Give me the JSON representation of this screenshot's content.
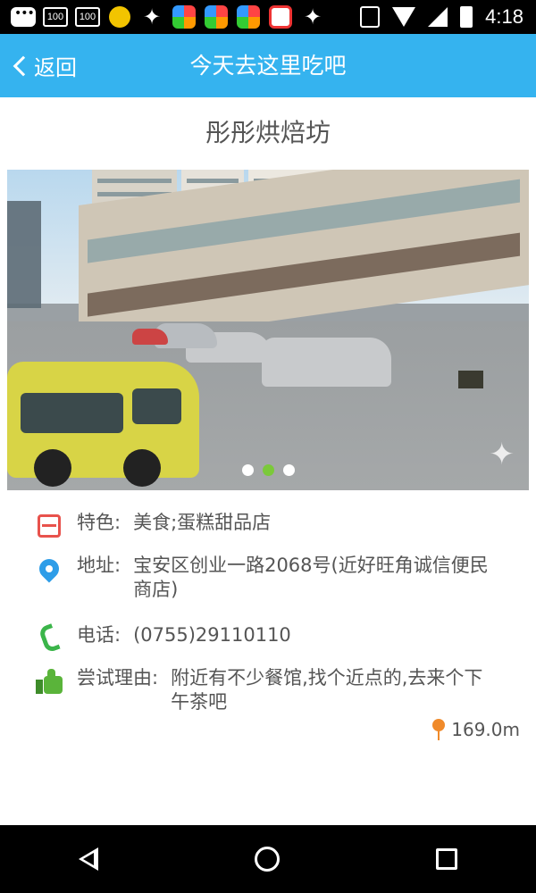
{
  "status_bar": {
    "time": "4:18",
    "notif_100_a": "100",
    "notif_100_b": "100"
  },
  "app_bar": {
    "back_label": "返回",
    "title": "今天去这里吃吧"
  },
  "shop": {
    "name": "彤彤烘焙坊",
    "carousel": {
      "total": 3,
      "active_index": 1
    }
  },
  "info": {
    "feature": {
      "label": "特色:",
      "value": "美食;蛋糕甜品店",
      "icon": "box-icon"
    },
    "address": {
      "label": "地址:",
      "value": "宝安区创业一路2068号(近好旺角诚信便民商店)",
      "icon": "location-pin-icon"
    },
    "phone": {
      "label": "电话:",
      "value": "(0755)29110110",
      "icon": "phone-icon"
    },
    "reason": {
      "label": "尝试理由:",
      "value": "附近有不少餐馆,找个近点的,去来个下午茶吧",
      "icon": "thumbs-up-icon"
    },
    "distance": "169.0m"
  },
  "colors": {
    "app_bar": "#35b3ef",
    "active_dot": "#7bc93a",
    "text": "#555555"
  }
}
